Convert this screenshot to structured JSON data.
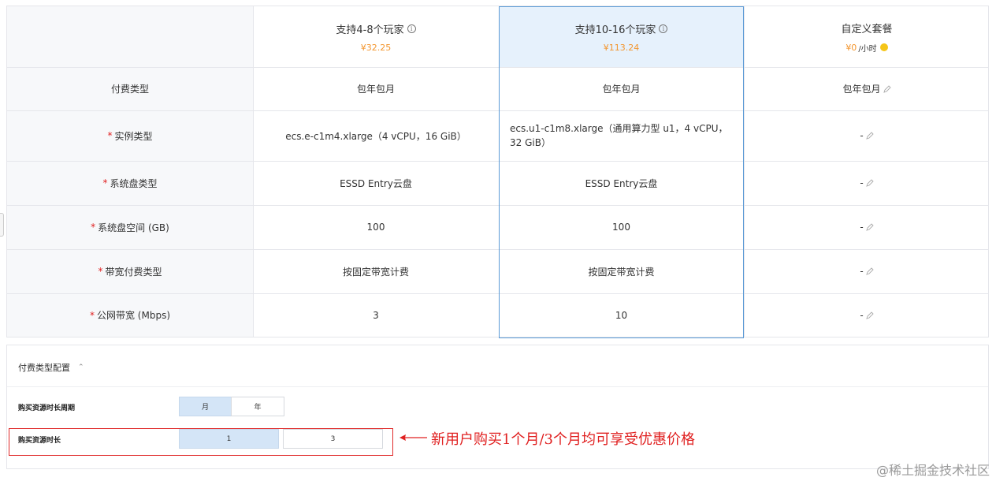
{
  "plans": [
    {
      "name": "支持4-8个玩家",
      "price": "¥32.25",
      "info": true
    },
    {
      "name": "支持10-16个玩家",
      "price": "¥113.24",
      "info": true,
      "highlighted": true
    },
    {
      "name": "自定义套餐",
      "price": "¥0",
      "unit": "/小时"
    }
  ],
  "rows": [
    {
      "label": "付费类型",
      "required": false,
      "values": [
        "包年包月",
        "包年包月",
        "包年包月"
      ]
    },
    {
      "label": "实例类型",
      "required": true,
      "values": [
        "ecs.e-c1m4.xlarge（4 vCPU，16 GiB）",
        "ecs.u1-c1m8.xlarge（通用算力型 u1，4 vCPU，32 GiB）",
        "-"
      ]
    },
    {
      "label": "系统盘类型",
      "required": true,
      "values": [
        "ESSD Entry云盘",
        "ESSD Entry云盘",
        "-"
      ]
    },
    {
      "label": "系统盘空间 (GB)",
      "required": true,
      "values": [
        "100",
        "100",
        "-"
      ]
    },
    {
      "label": "带宽付费类型",
      "required": true,
      "values": [
        "按固定带宽计费",
        "按固定带宽计费",
        "-"
      ]
    },
    {
      "label": "公网带宽 (Mbps)",
      "required": true,
      "values": [
        "3",
        "10",
        "-"
      ]
    }
  ],
  "config": {
    "title": "付费类型配置",
    "period_label": "购买资源时长周期",
    "period_options": [
      "月",
      "年"
    ],
    "period_selected": "月",
    "duration_label": "购买资源时长",
    "duration_options": [
      "1",
      "3"
    ],
    "duration_selected": "1"
  },
  "annotation": "新用户购买1个月/3个月均可享受优惠价格",
  "watermark": "@稀土掘金技术社区",
  "colors": {
    "accent": "#5a9ad6",
    "price": "#f3962f",
    "required": "#e02020",
    "annotation": "#e02020"
  }
}
